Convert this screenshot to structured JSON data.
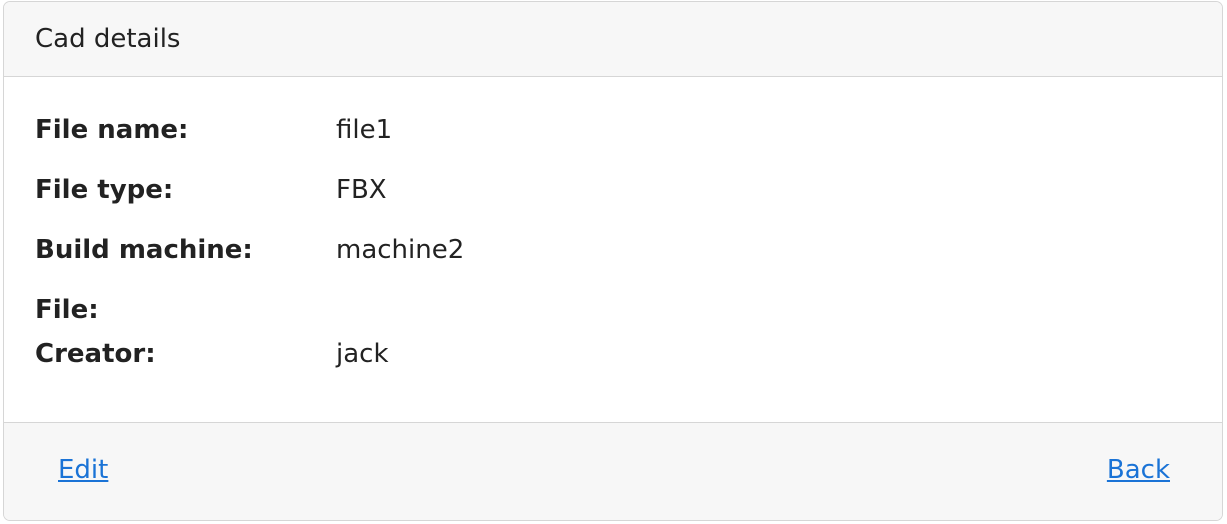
{
  "card": {
    "title": "Cad details"
  },
  "details": [
    {
      "label": "File name:",
      "value": "file1"
    },
    {
      "label": "File type:",
      "value": "FBX"
    },
    {
      "label": "Build machine:",
      "value": "machine2"
    },
    {
      "label": "File:",
      "value": ""
    },
    {
      "label": "Creator:",
      "value": "jack"
    }
  ],
  "footer": {
    "edit_label": "Edit",
    "back_label": "Back"
  },
  "colors": {
    "link": "#1a73d6",
    "header_bg": "#f7f7f7",
    "border": "#d6d6d6"
  }
}
